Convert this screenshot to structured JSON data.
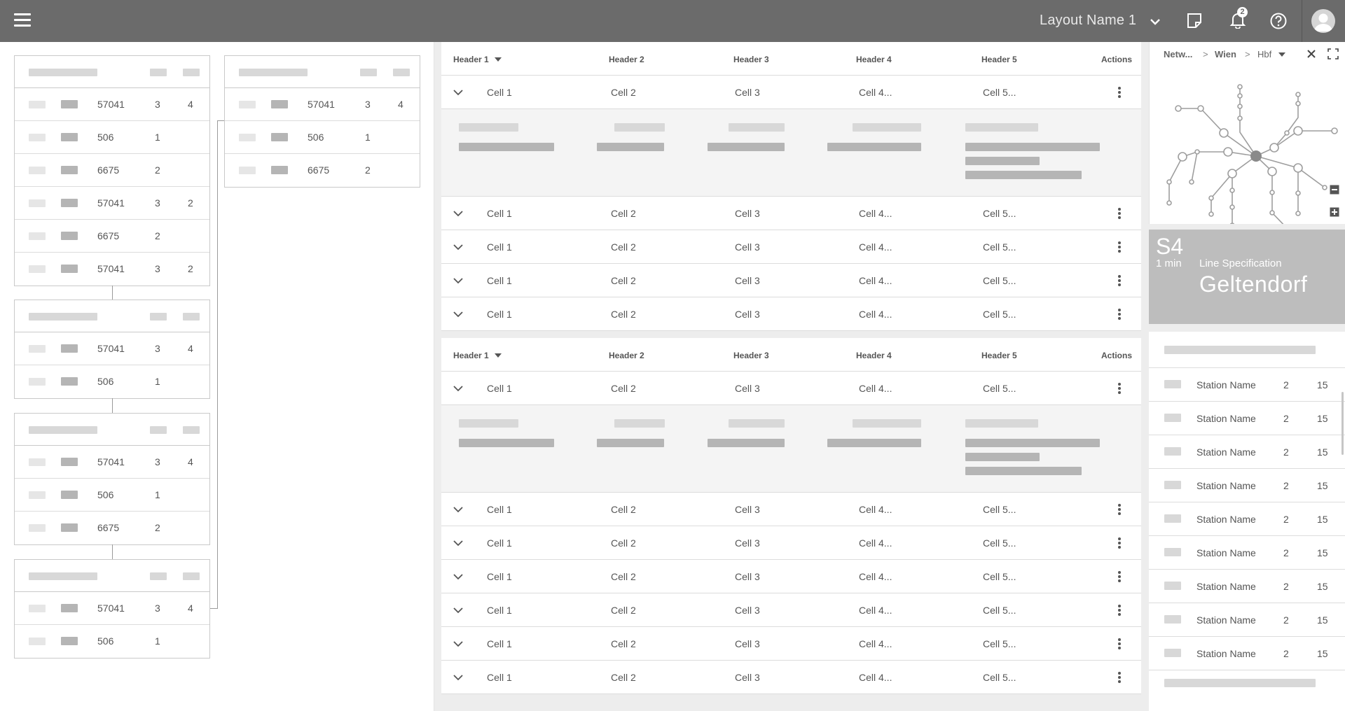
{
  "topbar": {
    "layout_name": "Layout Name 1",
    "notification_count": "2",
    "icons": [
      "menu-icon",
      "chevron-down-icon",
      "notes-icon",
      "bell-icon",
      "help-icon",
      "avatar-icon"
    ]
  },
  "tree": {
    "groups": [
      {
        "rows": [
          {
            "num": "57041",
            "c1": "3",
            "c2": "4"
          },
          {
            "num": "506",
            "c1": "1",
            "c2": ""
          },
          {
            "num": "6675",
            "c1": "2",
            "c2": ""
          },
          {
            "num": "57041",
            "c1": "3",
            "c2": "2"
          },
          {
            "num": "6675",
            "c1": "2",
            "c2": ""
          },
          {
            "num": "57041",
            "c1": "3",
            "c2": "2"
          }
        ]
      },
      {
        "rows": [
          {
            "num": "57041",
            "c1": "3",
            "c2": "4"
          },
          {
            "num": "506",
            "c1": "1",
            "c2": ""
          }
        ]
      },
      {
        "rows": [
          {
            "num": "57041",
            "c1": "3",
            "c2": "4"
          },
          {
            "num": "506",
            "c1": "1",
            "c2": ""
          },
          {
            "num": "6675",
            "c1": "2",
            "c2": ""
          }
        ]
      },
      {
        "rows": [
          {
            "num": "57041",
            "c1": "3",
            "c2": "4"
          },
          {
            "num": "506",
            "c1": "1",
            "c2": ""
          }
        ]
      },
      {
        "rows": [
          {
            "num": "57041",
            "c1": "3",
            "c2": "4"
          },
          {
            "num": "506",
            "c1": "1",
            "c2": ""
          },
          {
            "num": "6675",
            "c1": "2",
            "c2": ""
          }
        ]
      }
    ]
  },
  "tables": [
    {
      "headers": [
        "Header 1",
        "Header 2",
        "Header 3",
        "Header 4",
        "Header 5",
        "Actions"
      ],
      "rows": [
        {
          "c1": "Cell 1",
          "c2": "Cell 2",
          "c3": "Cell 3",
          "c4": "Cell 4...",
          "c5": "Cell 5..."
        },
        {
          "c1": "Cell 1",
          "c2": "Cell 2",
          "c3": "Cell 3",
          "c4": "Cell 4...",
          "c5": "Cell 5..."
        },
        {
          "c1": "Cell 1",
          "c2": "Cell 2",
          "c3": "Cell 3",
          "c4": "Cell 4...",
          "c5": "Cell 5..."
        },
        {
          "c1": "Cell 1",
          "c2": "Cell 2",
          "c3": "Cell 3",
          "c4": "Cell 4...",
          "c5": "Cell 5..."
        },
        {
          "c1": "Cell 1",
          "c2": "Cell 2",
          "c3": "Cell 3",
          "c4": "Cell 4...",
          "c5": "Cell 5..."
        }
      ]
    },
    {
      "headers": [
        "Header 1",
        "Header 2",
        "Header 3",
        "Header 4",
        "Header 5",
        "Actions"
      ],
      "rows": [
        {
          "c1": "Cell 1",
          "c2": "Cell 2",
          "c3": "Cell 3",
          "c4": "Cell 4...",
          "c5": "Cell 5..."
        },
        {
          "c1": "Cell 1",
          "c2": "Cell 2",
          "c3": "Cell 3",
          "c4": "Cell 4...",
          "c5": "Cell 5..."
        },
        {
          "c1": "Cell 1",
          "c2": "Cell 2",
          "c3": "Cell 3",
          "c4": "Cell 4...",
          "c5": "Cell 5..."
        },
        {
          "c1": "Cell 1",
          "c2": "Cell 2",
          "c3": "Cell 3",
          "c4": "Cell 4...",
          "c5": "Cell 5..."
        },
        {
          "c1": "Cell 1",
          "c2": "Cell 2",
          "c3": "Cell 3",
          "c4": "Cell 4...",
          "c5": "Cell 5..."
        },
        {
          "c1": "Cell 1",
          "c2": "Cell 2",
          "c3": "Cell 3",
          "c4": "Cell 4...",
          "c5": "Cell 5..."
        },
        {
          "c1": "Cell 1",
          "c2": "Cell 2",
          "c3": "Cell 3",
          "c4": "Cell 4...",
          "c5": "Cell 5..."
        }
      ]
    }
  ],
  "map": {
    "breadcrumb": [
      "Netw...",
      "Wien",
      "Hbf"
    ],
    "separator": ">"
  },
  "line": {
    "name": "S4",
    "duration": "1 min",
    "spec_label": "Line Specification",
    "destination": "Geltendorf"
  },
  "stations": [
    {
      "name": "Station Name",
      "a": "2",
      "b": "15"
    },
    {
      "name": "Station Name",
      "a": "2",
      "b": "15"
    },
    {
      "name": "Station Name",
      "a": "2",
      "b": "15"
    },
    {
      "name": "Station Name",
      "a": "2",
      "b": "15"
    },
    {
      "name": "Station Name",
      "a": "2",
      "b": "15"
    },
    {
      "name": "Station Name",
      "a": "2",
      "b": "15"
    },
    {
      "name": "Station Name",
      "a": "2",
      "b": "15"
    },
    {
      "name": "Station Name",
      "a": "2",
      "b": "15"
    },
    {
      "name": "Station Name",
      "a": "2",
      "b": "15"
    }
  ],
  "colors": {
    "topbar": "#6b6b6b",
    "line_card": "#bdbdbd",
    "background": "#ededed"
  }
}
